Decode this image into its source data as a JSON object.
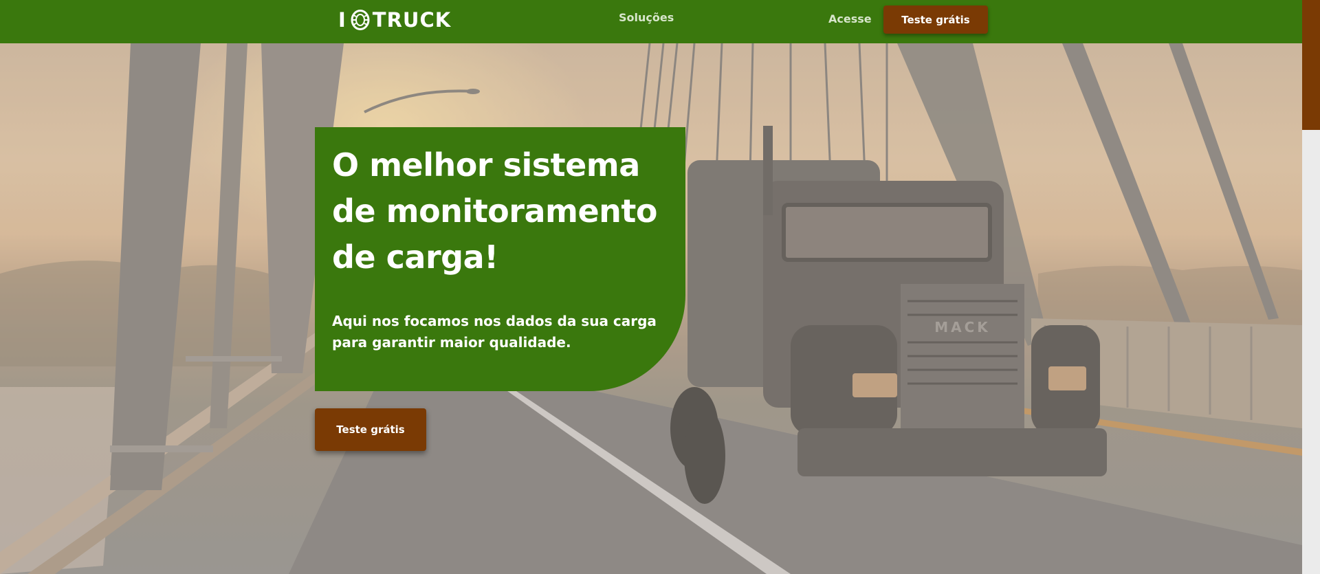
{
  "nav": {
    "logo_text": "TRUCK",
    "logo_prefix": "I",
    "solucoes_label": "Soluções",
    "acesse_label": "Acesse",
    "cta_label": "Teste grátis"
  },
  "hero": {
    "title": "O melhor sistema de monitoramento de carga!",
    "subtitle": "Aqui nos focamos nos dados da sua carga para garantir maior qualidade.",
    "cta_label": "Teste grátis",
    "truck_grille_text": "MACK"
  },
  "colors": {
    "brand_green": "#3a780d",
    "cta_brown": "#7a3a04",
    "scroll_track": "#ebebeb"
  },
  "icons": {
    "logo_icon": "tire-icon"
  }
}
